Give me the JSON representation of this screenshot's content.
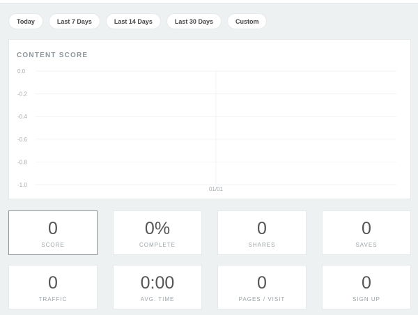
{
  "ranges": [
    "Today",
    "Last 7 Days",
    "Last 14 Days",
    "Last 30 Days",
    "Custom"
  ],
  "chart_data": {
    "type": "line",
    "title": "CONTENT SCORE",
    "x": [
      "01/01"
    ],
    "series": [
      {
        "values": [
          0
        ]
      }
    ],
    "yticks": [
      "0.0",
      "-0.2",
      "-0.4",
      "-0.6",
      "-0.8",
      "-1.0"
    ],
    "ylim": [
      -1.0,
      0.0
    ],
    "grid": true
  },
  "metrics": [
    {
      "value": "0",
      "label": "SCORE",
      "selected": true
    },
    {
      "value": "0%",
      "label": "COMPLETE",
      "selected": false
    },
    {
      "value": "0",
      "label": "SHARES",
      "selected": false
    },
    {
      "value": "0",
      "label": "SAVES",
      "selected": false
    },
    {
      "value": "0",
      "label": "TRAFFIC",
      "selected": false
    },
    {
      "value": "0:00",
      "label": "AVG. TIME",
      "selected": false
    },
    {
      "value": "0",
      "label": "PAGES / VISIT",
      "selected": false
    },
    {
      "value": "0",
      "label": "SIGN UP",
      "selected": false
    }
  ]
}
